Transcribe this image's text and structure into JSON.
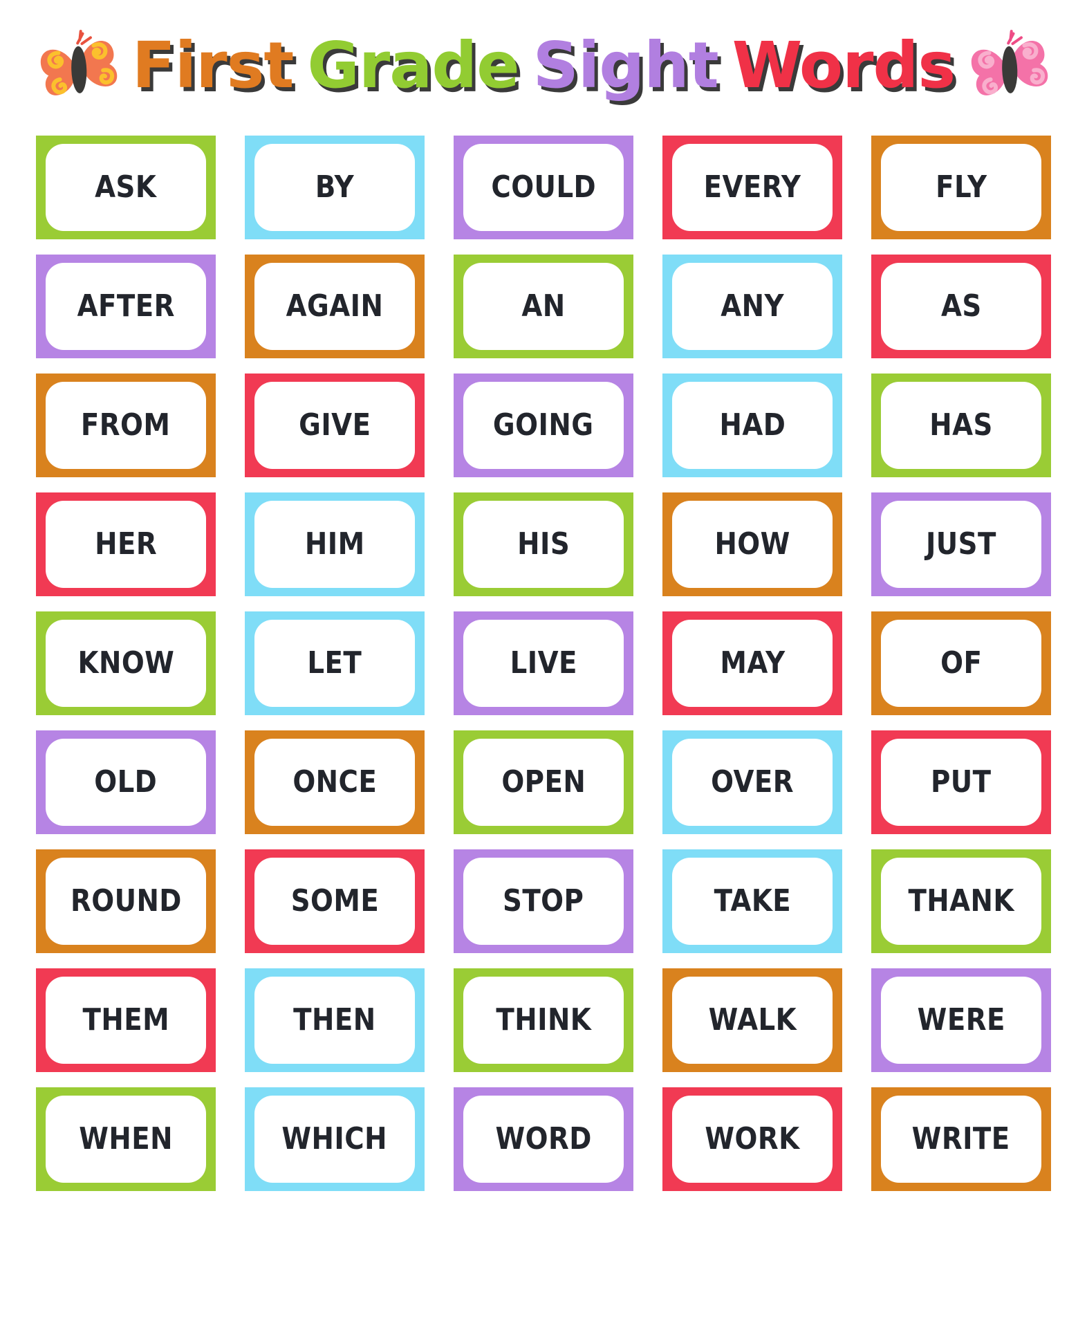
{
  "header": {
    "title_words": [
      {
        "text": "First",
        "color": "#E07B21"
      },
      {
        "text": "Grade",
        "color": "#92CC32"
      },
      {
        "text": "Sight",
        "color": "#B17FE0"
      },
      {
        "text": "Words",
        "color": "#F03147"
      }
    ],
    "title_full": "First Grade Sight Words",
    "left_icon": "butterfly-icon",
    "right_icon": "butterfly-icon",
    "left_icon_colors": {
      "wing": "#F2774F",
      "swirl": "#FBC02D",
      "body": "#3A3A38"
    },
    "right_icon_colors": {
      "wing": "#F472A8",
      "swirl": "#F9AFCD",
      "body": "#3A3A38"
    }
  },
  "palette": {
    "green": "#9ACC35",
    "cyan": "#7FDDF7",
    "purple": "#B684E4",
    "red": "#F13A53",
    "orange": "#D9821E",
    "card_face": "#FFFFFF",
    "word_text": "#22252C"
  },
  "grid": {
    "columns": 5,
    "rows": 9,
    "cards": [
      {
        "word": "ASK",
        "color": "#9ACC35"
      },
      {
        "word": "BY",
        "color": "#7FDDF7"
      },
      {
        "word": "COULD",
        "color": "#B684E4"
      },
      {
        "word": "EVERY",
        "color": "#F13A53"
      },
      {
        "word": "FLY",
        "color": "#D9821E"
      },
      {
        "word": "AFTER",
        "color": "#B684E4"
      },
      {
        "word": "AGAIN",
        "color": "#D9821E"
      },
      {
        "word": "AN",
        "color": "#9ACC35"
      },
      {
        "word": "ANY",
        "color": "#7FDDF7"
      },
      {
        "word": "AS",
        "color": "#F13A53"
      },
      {
        "word": "FROM",
        "color": "#D9821E"
      },
      {
        "word": "GIVE",
        "color": "#F13A53"
      },
      {
        "word": "GOING",
        "color": "#B684E4"
      },
      {
        "word": "HAD",
        "color": "#7FDDF7"
      },
      {
        "word": "HAS",
        "color": "#9ACC35"
      },
      {
        "word": "HER",
        "color": "#F13A53"
      },
      {
        "word": "HIM",
        "color": "#7FDDF7"
      },
      {
        "word": "HIS",
        "color": "#9ACC35"
      },
      {
        "word": "HOW",
        "color": "#D9821E"
      },
      {
        "word": "JUST",
        "color": "#B684E4"
      },
      {
        "word": "KNOW",
        "color": "#9ACC35"
      },
      {
        "word": "LET",
        "color": "#7FDDF7"
      },
      {
        "word": "LIVE",
        "color": "#B684E4"
      },
      {
        "word": "MAY",
        "color": "#F13A53"
      },
      {
        "word": "OF",
        "color": "#D9821E"
      },
      {
        "word": "OLD",
        "color": "#B684E4"
      },
      {
        "word": "ONCE",
        "color": "#D9821E"
      },
      {
        "word": "OPEN",
        "color": "#9ACC35"
      },
      {
        "word": "OVER",
        "color": "#7FDDF7"
      },
      {
        "word": "PUT",
        "color": "#F13A53"
      },
      {
        "word": "ROUND",
        "color": "#D9821E"
      },
      {
        "word": "SOME",
        "color": "#F13A53"
      },
      {
        "word": "STOP",
        "color": "#B684E4"
      },
      {
        "word": "TAKE",
        "color": "#7FDDF7"
      },
      {
        "word": "THANK",
        "color": "#9ACC35"
      },
      {
        "word": "THEM",
        "color": "#F13A53"
      },
      {
        "word": "THEN",
        "color": "#7FDDF7"
      },
      {
        "word": "THINK",
        "color": "#9ACC35"
      },
      {
        "word": "WALK",
        "color": "#D9821E"
      },
      {
        "word": "WERE",
        "color": "#B684E4"
      },
      {
        "word": "WHEN",
        "color": "#9ACC35"
      },
      {
        "word": "WHICH",
        "color": "#7FDDF7"
      },
      {
        "word": "WORD",
        "color": "#B684E4"
      },
      {
        "word": "WORK",
        "color": "#F13A53"
      },
      {
        "word": "WRITE",
        "color": "#D9821E"
      }
    ]
  }
}
